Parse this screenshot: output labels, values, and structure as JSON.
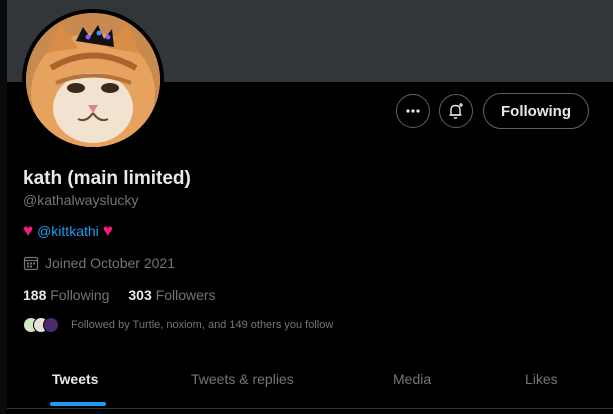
{
  "profile": {
    "name": "kath (main limited)",
    "handle": "@kathalwayslucky",
    "bio": {
      "heart_left": "♥",
      "mention": "@kittkathi",
      "heart_right": "♥"
    },
    "joined": "Joined October 2021",
    "stats": {
      "following_count": "188",
      "following_label": "Following",
      "followers_count": "303",
      "followers_label": "Followers"
    },
    "followed_by": "Followed by Turtle, noxiom, and 149 others you follow"
  },
  "actions": {
    "following_label": "Following"
  },
  "tabs": [
    {
      "label": "Tweets"
    },
    {
      "label": "Tweets & replies"
    },
    {
      "label": "Media"
    },
    {
      "label": "Likes"
    }
  ],
  "colors": {
    "accent": "#1d9bf0",
    "heart": "#f91880",
    "banner": "#333639",
    "background": "#000000"
  },
  "icons": {
    "more": "more-icon",
    "notify": "bell-plus-icon",
    "calendar": "calendar-icon"
  }
}
